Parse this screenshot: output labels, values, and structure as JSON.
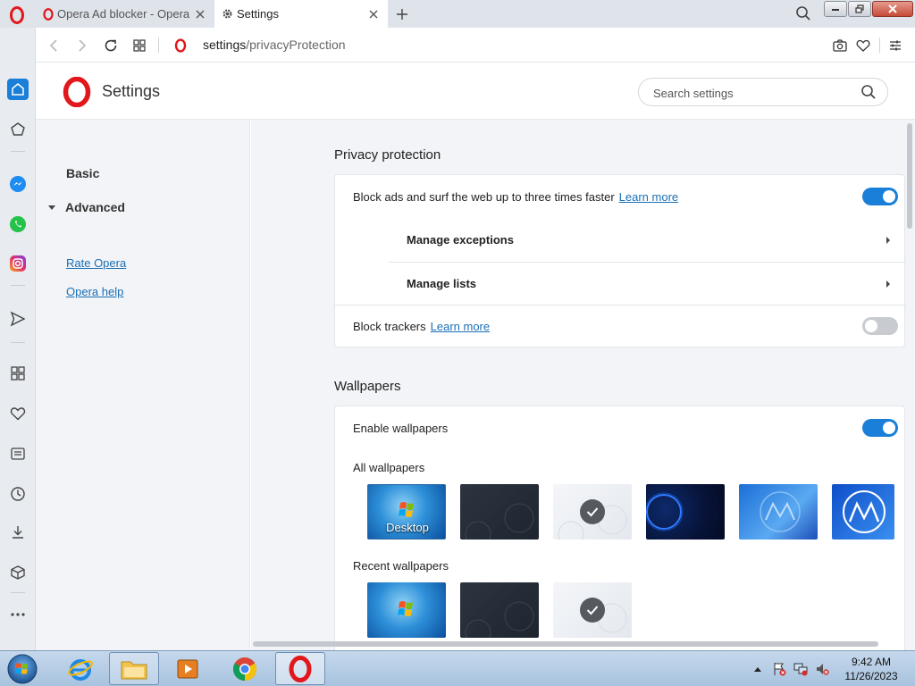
{
  "browser": {
    "tabs": [
      {
        "title": "Opera Ad blocker - Opera",
        "active": false
      },
      {
        "title": "Settings",
        "active": true
      }
    ],
    "url": {
      "host": "settings",
      "path": "/privacyProtection"
    }
  },
  "settings": {
    "title": "Settings",
    "search_placeholder": "Search settings",
    "nav": {
      "basic": "Basic",
      "advanced": "Advanced",
      "rate": "Rate Opera",
      "help": "Opera help"
    },
    "privacy": {
      "title": "Privacy protection",
      "block_ads": {
        "text": "Block ads and surf the web up to three times faster",
        "link": "Learn more",
        "enabled": true
      },
      "manage_exceptions": "Manage exceptions",
      "manage_lists": "Manage lists",
      "block_trackers": {
        "text": "Block trackers",
        "link": "Learn more",
        "enabled": false
      }
    },
    "wallpapers": {
      "title": "Wallpapers",
      "enable": {
        "text": "Enable wallpapers",
        "enabled": true
      },
      "all_label": "All wallpapers",
      "recent_label": "Recent wallpapers",
      "desktop_label": "Desktop",
      "selected_index": 2
    }
  },
  "taskbar": {
    "time": "9:42 AM",
    "date": "11/26/2023"
  },
  "colors": {
    "accent": "#1a7fd8",
    "opera_red": "#e2161b",
    "link": "#1b6fb5"
  }
}
